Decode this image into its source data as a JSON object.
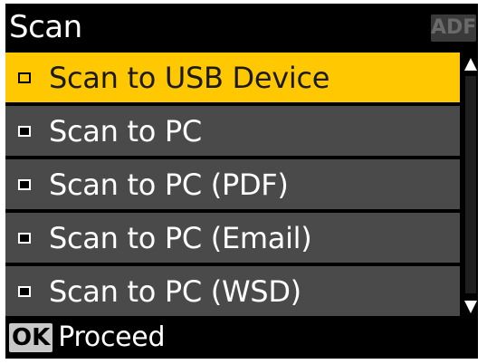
{
  "header": {
    "title": "Scan",
    "adf_badge": "ADF"
  },
  "menu": {
    "selected_index": 0,
    "items": [
      {
        "label": "Scan to USB Device"
      },
      {
        "label": "Scan to PC"
      },
      {
        "label": "Scan to PC (PDF)"
      },
      {
        "label": "Scan to PC (Email)"
      },
      {
        "label": "Scan to PC (WSD)"
      }
    ]
  },
  "footer": {
    "ok_key": "OK",
    "action_label": "Proceed"
  },
  "colors": {
    "background": "#000000",
    "item_background": "#4a4a4a",
    "selected_background": "#ffc800",
    "text": "#ffffff"
  }
}
